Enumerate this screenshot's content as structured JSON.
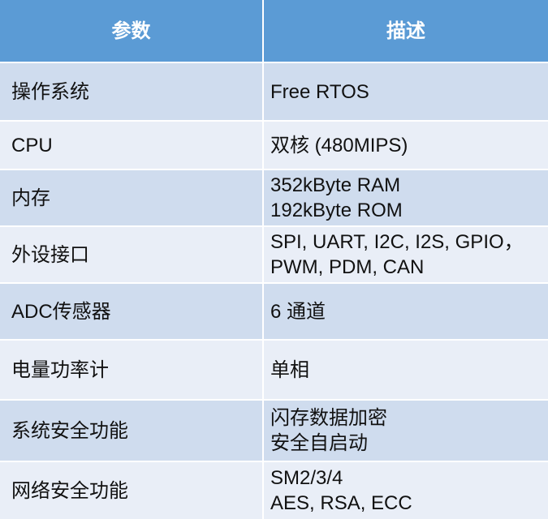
{
  "table": {
    "headers": [
      "参数",
      "描述"
    ],
    "rows": [
      {
        "param": "操作系统",
        "desc": [
          "Free RTOS"
        ]
      },
      {
        "param": "CPU",
        "desc": [
          "双核 (480MIPS)"
        ]
      },
      {
        "param": "内存",
        "desc": [
          "352kByte RAM",
          "192kByte ROM"
        ]
      },
      {
        "param": "外设接口",
        "desc": [
          "SPI, UART, I2C, I2S, GPIO，",
          "PWM, PDM, CAN"
        ]
      },
      {
        "param": "ADC传感器",
        "desc": [
          "6 通道"
        ]
      },
      {
        "param": "电量功率计",
        "desc": [
          "单相"
        ]
      },
      {
        "param": "系统安全功能",
        "desc": [
          "闪存数据加密",
          "安全自启动"
        ]
      },
      {
        "param": "网络安全功能",
        "desc": [
          "SM2/3/4",
          "AES, RSA, ECC"
        ]
      }
    ]
  },
  "colors": {
    "header_bg": "#5b9bd5",
    "row_dark": "#cfdcee",
    "row_light": "#e9eef7",
    "text": "#111111"
  }
}
